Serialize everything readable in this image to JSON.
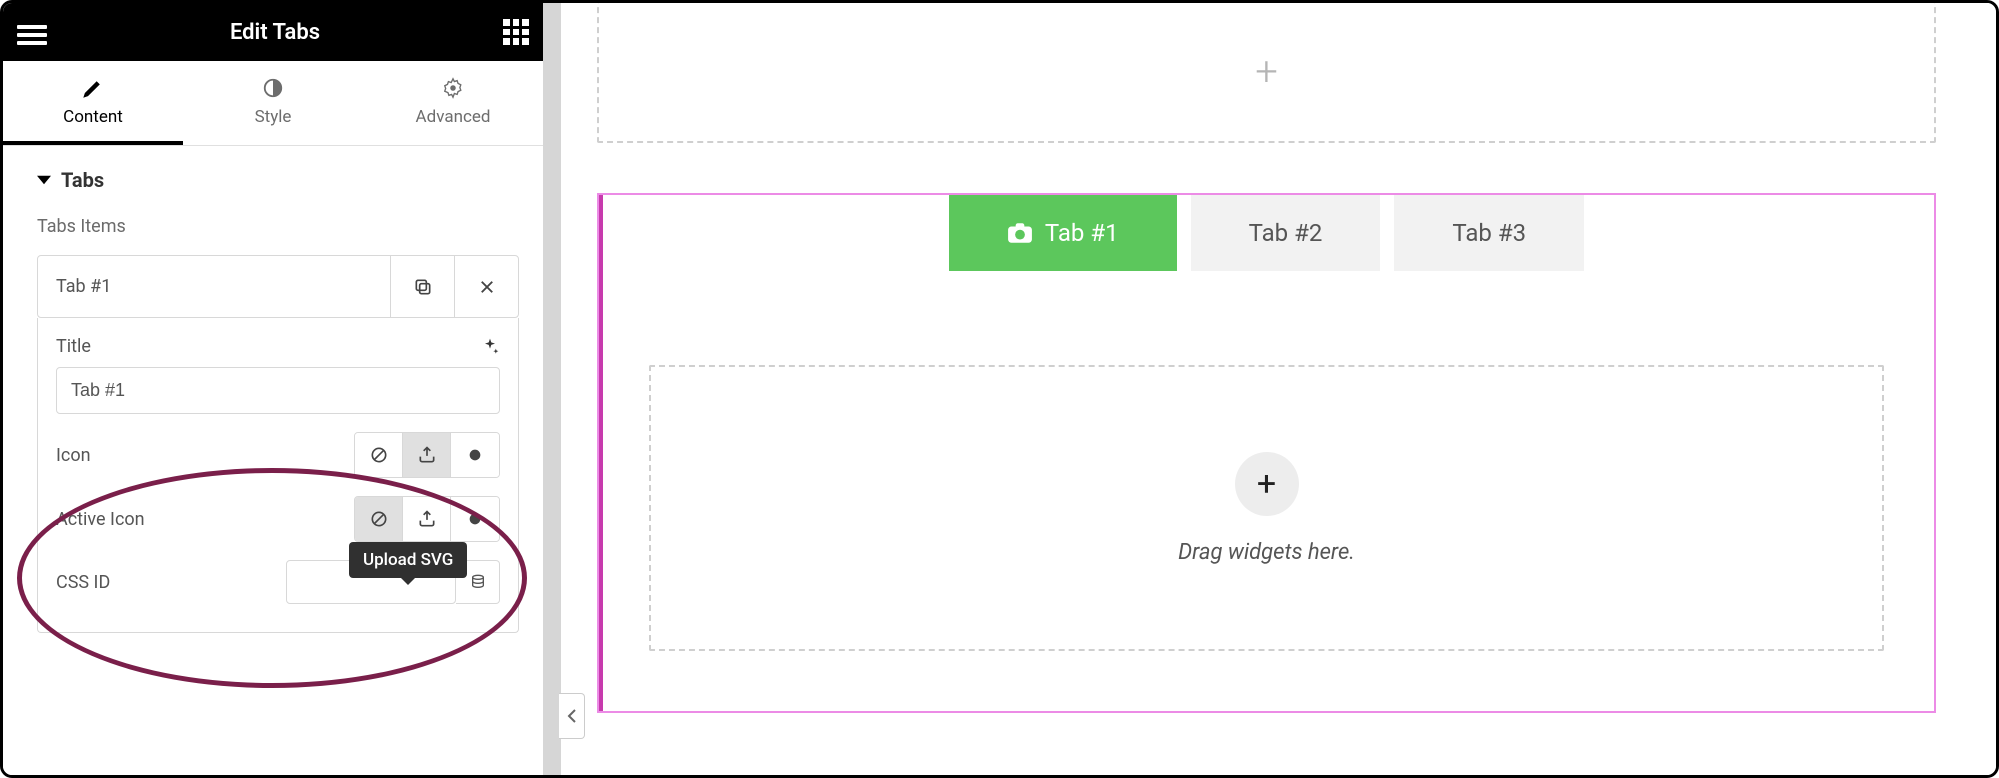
{
  "panel": {
    "title": "Edit Tabs",
    "nav": {
      "content": "Content",
      "style": "Style",
      "advanced": "Advanced"
    },
    "section": {
      "title": "Tabs"
    },
    "items_label": "Tabs Items",
    "item": {
      "title": "Tab #1"
    },
    "controls": {
      "title_label": "Title",
      "title_value": "Tab #1",
      "icon_label": "Icon",
      "active_icon_label": "Active Icon",
      "css_id_label": "CSS ID",
      "css_id_value": ""
    },
    "tooltip": "Upload SVG"
  },
  "canvas": {
    "tabs": [
      {
        "label": "Tab #1",
        "active": true
      },
      {
        "label": "Tab #2",
        "active": false
      },
      {
        "label": "Tab #3",
        "active": false
      }
    ],
    "drop_text": "Drag widgets here."
  }
}
